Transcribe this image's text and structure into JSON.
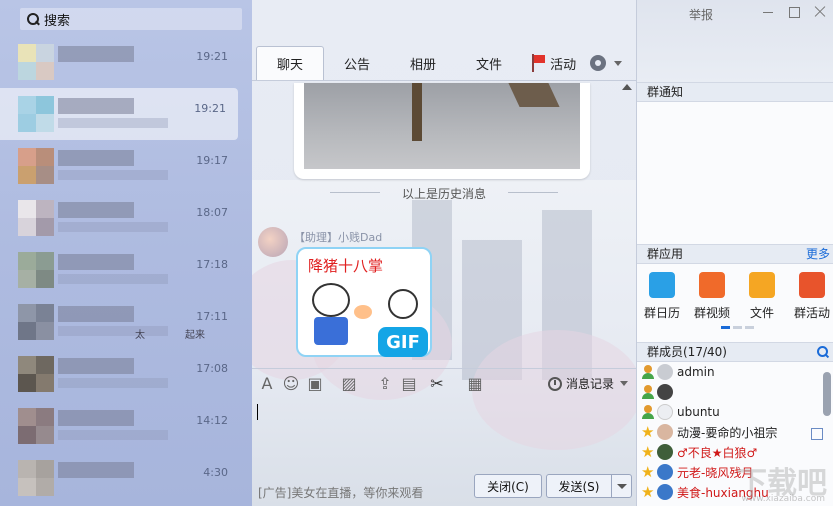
{
  "search": {
    "placeholder": "搜索"
  },
  "conversations": [
    {
      "time": "19:21",
      "selected": false
    },
    {
      "time": "19:21",
      "selected": true
    },
    {
      "time": "19:17",
      "selected": false
    },
    {
      "time": "18:07",
      "selected": false
    },
    {
      "time": "17:18",
      "selected": false
    },
    {
      "time": "17:11",
      "selected": false,
      "snippet_a": "太",
      "snippet_b": "起来"
    },
    {
      "time": "17:08",
      "selected": false
    },
    {
      "time": "14:12",
      "selected": false
    },
    {
      "time": "4:30",
      "selected": false
    }
  ],
  "tabs": [
    "聊天",
    "公告",
    "相册",
    "文件",
    "活动"
  ],
  "chat": {
    "history_divider": "以上是历史消息",
    "sender": "【助理】小贱Dad",
    "sticker_caption": "降猪十八掌",
    "gif_badge": "GIF",
    "history_button": "消息记录",
    "ad_text": "[广告]美女在直播，等你来观看",
    "close_button": "关闭(C)",
    "send_button": "发送(S)"
  },
  "window": {
    "report": "举报"
  },
  "right_panel": {
    "notice_title": "群通知",
    "apps_title": "群应用",
    "apps_more": "更多",
    "apps": [
      {
        "label": "群日历",
        "icon": "calendar-icon",
        "color": "#2aa0e6"
      },
      {
        "label": "群视频",
        "icon": "video-icon",
        "color": "#f06a2a"
      },
      {
        "label": "文件",
        "icon": "folder-icon",
        "color": "#f5a623"
      },
      {
        "label": "群活动",
        "icon": "flag-icon",
        "color": "#e8542c"
      }
    ],
    "members_title": "群成员(17/40)",
    "members": [
      {
        "name": "admin",
        "role": "person",
        "style": ""
      },
      {
        "name": "",
        "role": "person",
        "style": ""
      },
      {
        "name": "ubuntu",
        "role": "person",
        "style": ""
      },
      {
        "name": "动漫-要命的小祖宗",
        "role": "star",
        "style": ""
      },
      {
        "name": "♂不良★白狼♂",
        "role": "star",
        "style": "red"
      },
      {
        "name": "元老-晓风残月",
        "role": "star",
        "style": "red"
      },
      {
        "name": "美食-huxianghu",
        "role": "star",
        "style": "red"
      }
    ],
    "watermark": "下载吧",
    "watermark_small": "www.xiazaiba.com"
  }
}
